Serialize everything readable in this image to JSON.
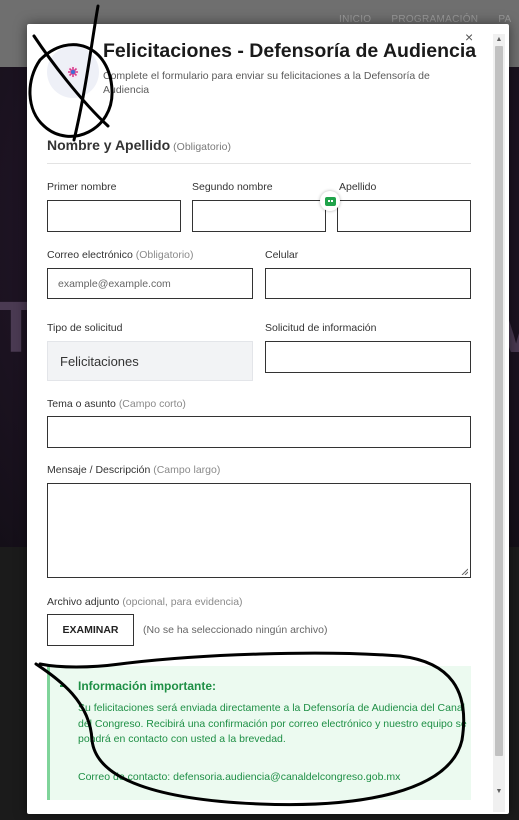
{
  "background": {
    "nav": [
      "INICIO",
      "PROGRAMACIÓN",
      "PA"
    ]
  },
  "modal": {
    "close_label": "×",
    "title": "Felicitaciones - Defensoría de Audiencia",
    "subtitle": "Complete el formulario para enviar su felicitaciones a la Defensoría de Audiencia",
    "logo_icon": "channel-logo-icon"
  },
  "form": {
    "name_section": {
      "title": "Nombre y Apellido",
      "hint": "(Obligatorio)"
    },
    "first_name": {
      "label": "Primer nombre",
      "value": ""
    },
    "middle_name": {
      "label": "Segundo nombre",
      "value": ""
    },
    "last_name": {
      "label": "Apellido",
      "value": ""
    },
    "email": {
      "label": "Correo electrónico",
      "hint": "(Obligatorio)",
      "placeholder": "example@example.com"
    },
    "phone": {
      "label": "Celular",
      "value": ""
    },
    "request_type": {
      "label": "Tipo de solicitud",
      "value": "Felicitaciones"
    },
    "info_request": {
      "label": "Solicitud de información",
      "value": ""
    },
    "subject": {
      "label": "Tema o asunto",
      "hint": "(Campo corto)",
      "value": ""
    },
    "message": {
      "label": "Mensaje / Descripción",
      "hint": "(Campo largo)",
      "value": ""
    },
    "attachment": {
      "label": "Archivo adjunto",
      "hint": "(opcional, para evidencia)",
      "button": "EXAMINAR",
      "status": "(No se ha seleccionado ningún archivo)"
    }
  },
  "info": {
    "title": "Información importante:",
    "body": "Su felicitaciones será enviada directamente a la Defensoría de Audiencia del Canal del Congreso. Recibirá una confirmación por correo electrónico y nuestro equipo se pondrá en contacto con usted a la brevedad.",
    "contact": "Correo de contacto: defensoria.audiencia@canaldelcongreso.gob.mx"
  },
  "colors": {
    "accent_green": "#1e8f45",
    "info_bg": "#ecfaf0",
    "border": "#333333"
  }
}
